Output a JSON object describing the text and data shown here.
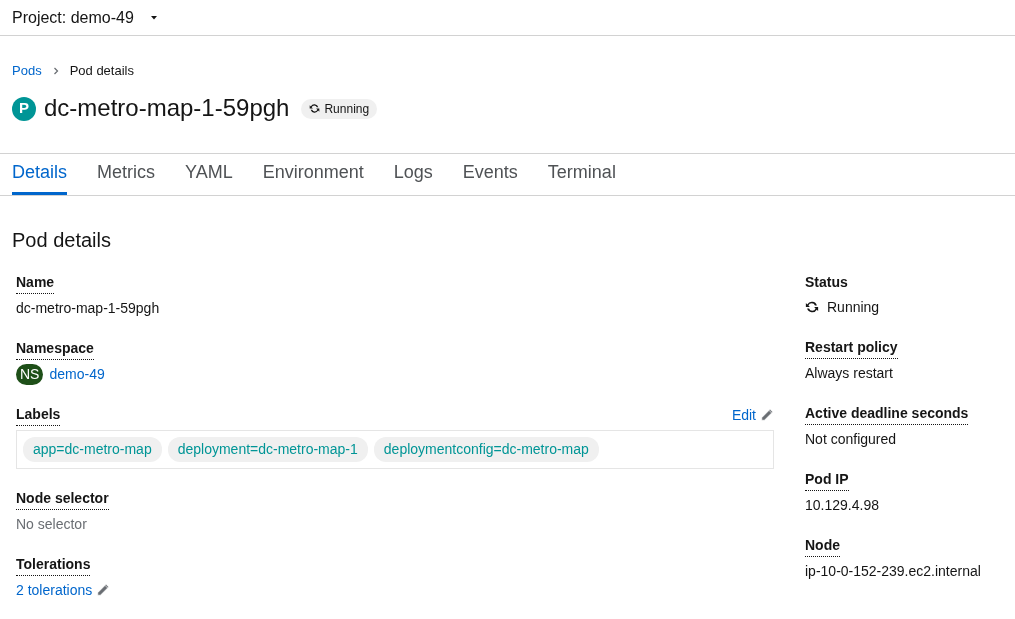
{
  "project_bar": {
    "label": "Project: demo-49"
  },
  "breadcrumb": [
    {
      "text": "Pods",
      "link": true
    },
    {
      "text": "Pod details",
      "link": false
    }
  ],
  "title": {
    "badge": "P",
    "name": "dc-metro-map-1-59pgh",
    "status": "Running"
  },
  "tabs": [
    {
      "label": "Details",
      "selected": true
    },
    {
      "label": "Metrics",
      "selected": false
    },
    {
      "label": "YAML",
      "selected": false
    },
    {
      "label": "Environment",
      "selected": false
    },
    {
      "label": "Logs",
      "selected": false
    },
    {
      "label": "Events",
      "selected": false
    },
    {
      "label": "Terminal",
      "selected": false
    }
  ],
  "section_title": "Pod details",
  "left_fields": [
    {
      "kind": "text",
      "label": "Name",
      "help": true,
      "value": "dc-metro-map-1-59pgh"
    },
    {
      "kind": "resource",
      "label": "Namespace",
      "help": true,
      "badge": "NS",
      "value": "demo-49"
    },
    {
      "kind": "labels",
      "label": "Labels",
      "help": true,
      "edit": "Edit",
      "chips": [
        "app=dc-metro-map",
        "deployment=dc-metro-map-1",
        "deploymentconfig=dc-metro-map"
      ]
    },
    {
      "kind": "muted",
      "label": "Node selector",
      "help": true,
      "value": "No selector"
    },
    {
      "kind": "link-edit",
      "label": "Tolerations",
      "help": true,
      "value": "2 tolerations"
    }
  ],
  "right_fields": [
    {
      "kind": "status",
      "label": "Status",
      "help": false,
      "value": "Running"
    },
    {
      "kind": "text",
      "label": "Restart policy",
      "help": true,
      "value": "Always restart"
    },
    {
      "kind": "text",
      "label": "Active deadline seconds",
      "help": true,
      "value": "Not configured"
    },
    {
      "kind": "text",
      "label": "Pod IP",
      "help": true,
      "value": "10.129.4.98"
    },
    {
      "kind": "text",
      "label": "Node",
      "help": true,
      "value": "ip-10-0-152-239.ec2.internal"
    }
  ]
}
